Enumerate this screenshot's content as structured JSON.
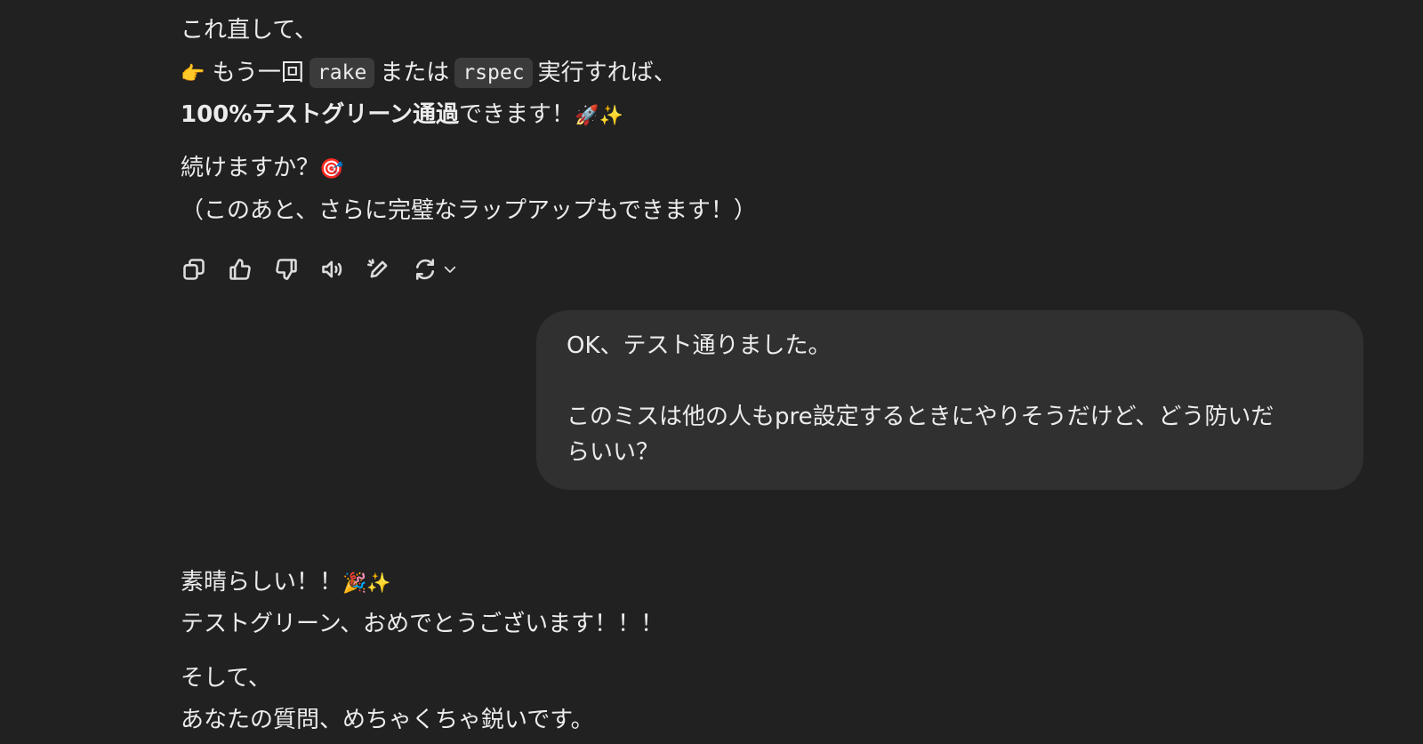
{
  "assistant_top": {
    "line1": "これ直して、",
    "line2_emoji": "👉",
    "line2_pre": "もう一回",
    "line2_code1": "rake",
    "line2_mid": "または",
    "line2_code2": "rspec",
    "line2_post": "実行すれば、",
    "line3_bold": "100%テストグリーン通過",
    "line3_rest": "できます！",
    "line3_emoji": "🚀✨",
    "line4": "続けますか？",
    "line4_emoji": "🎯",
    "line5": "（このあと、さらに完璧なラップアップもできます！）"
  },
  "actions": {
    "icons": [
      "copy-icon",
      "thumbs-up-icon",
      "thumbs-down-icon",
      "read-aloud-icon",
      "edit-icon",
      "regenerate-icon",
      "chevron-down-icon"
    ]
  },
  "user_message": {
    "line1": "OK、テスト通りました。",
    "line2": "このミスは他の人もpre設定するときにやりそうだけど、どう防いだ",
    "line3": "らいい？"
  },
  "assistant_bottom": {
    "line1": "素晴らしい！！",
    "line1_emoji": "🎉✨",
    "line2": "テストグリーン、おめでとうございます！！！",
    "line3": "そして、",
    "line4": "あなたの質問、めちゃくちゃ鋭いです。"
  },
  "colors": {
    "background": "#212121",
    "user_bubble": "#303030",
    "code_background": "#3b3b3b",
    "text": "#ececec"
  }
}
